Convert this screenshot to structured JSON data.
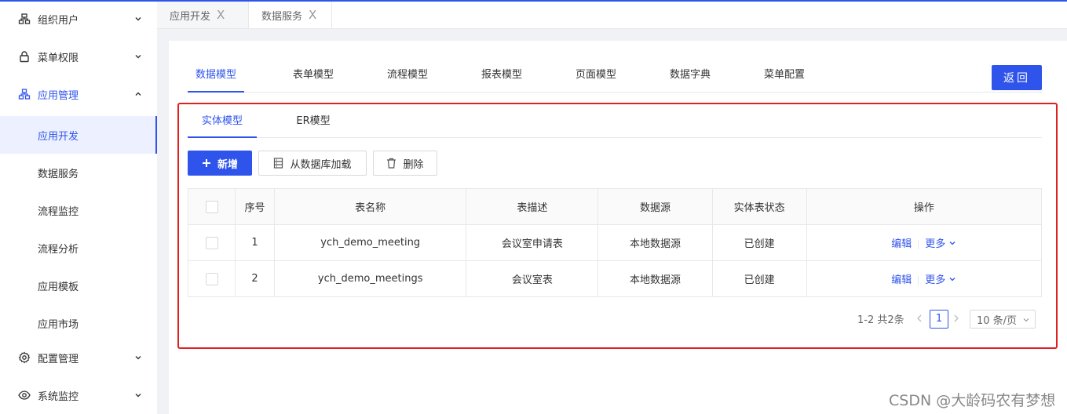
{
  "colors": {
    "accent": "#2f54eb",
    "highlight": "#e02020"
  },
  "sidebar": {
    "items": [
      {
        "label": "组织用户",
        "icon": "org-icon"
      },
      {
        "label": "菜单权限",
        "icon": "lock-icon"
      },
      {
        "label": "应用管理",
        "icon": "app-tree-icon",
        "expanded": true
      },
      {
        "label": "配置管理",
        "icon": "gear-icon"
      },
      {
        "label": "系统监控",
        "icon": "eye-icon"
      }
    ],
    "sub_items": [
      {
        "label": "应用开发",
        "selected": true
      },
      {
        "label": "数据服务"
      },
      {
        "label": "流程监控"
      },
      {
        "label": "流程分析"
      },
      {
        "label": "应用模板"
      },
      {
        "label": "应用市场"
      }
    ]
  },
  "page_tabs": [
    {
      "label": "应用开发",
      "close": "X"
    },
    {
      "label": "数据服务",
      "close": "X"
    }
  ],
  "main_tabs": [
    "数据模型",
    "表单模型",
    "流程模型",
    "报表模型",
    "页面模型",
    "数据字典",
    "菜单配置"
  ],
  "back_label": "返回",
  "sub_tabs": [
    "实体模型",
    "ER模型"
  ],
  "toolbar": {
    "add_label": "新增",
    "load_label": "从数据库加载",
    "delete_label": "删除"
  },
  "table": {
    "columns": [
      "序号",
      "表名称",
      "表描述",
      "数据源",
      "实体表状态",
      "操作"
    ],
    "rows": [
      {
        "index": "1",
        "name": "ych_demo_meeting",
        "desc": "会议室申请表",
        "source": "本地数据源",
        "status": "已创建",
        "edit": "编辑",
        "more": "更多"
      },
      {
        "index": "2",
        "name": "ych_demo_meetings",
        "desc": "会议室表",
        "source": "本地数据源",
        "status": "已创建",
        "edit": "编辑",
        "more": "更多"
      }
    ]
  },
  "pagination": {
    "total": "1-2 共2条",
    "current": "1",
    "page_size": "10 条/页"
  },
  "watermark": "CSDN @大龄码农有梦想"
}
